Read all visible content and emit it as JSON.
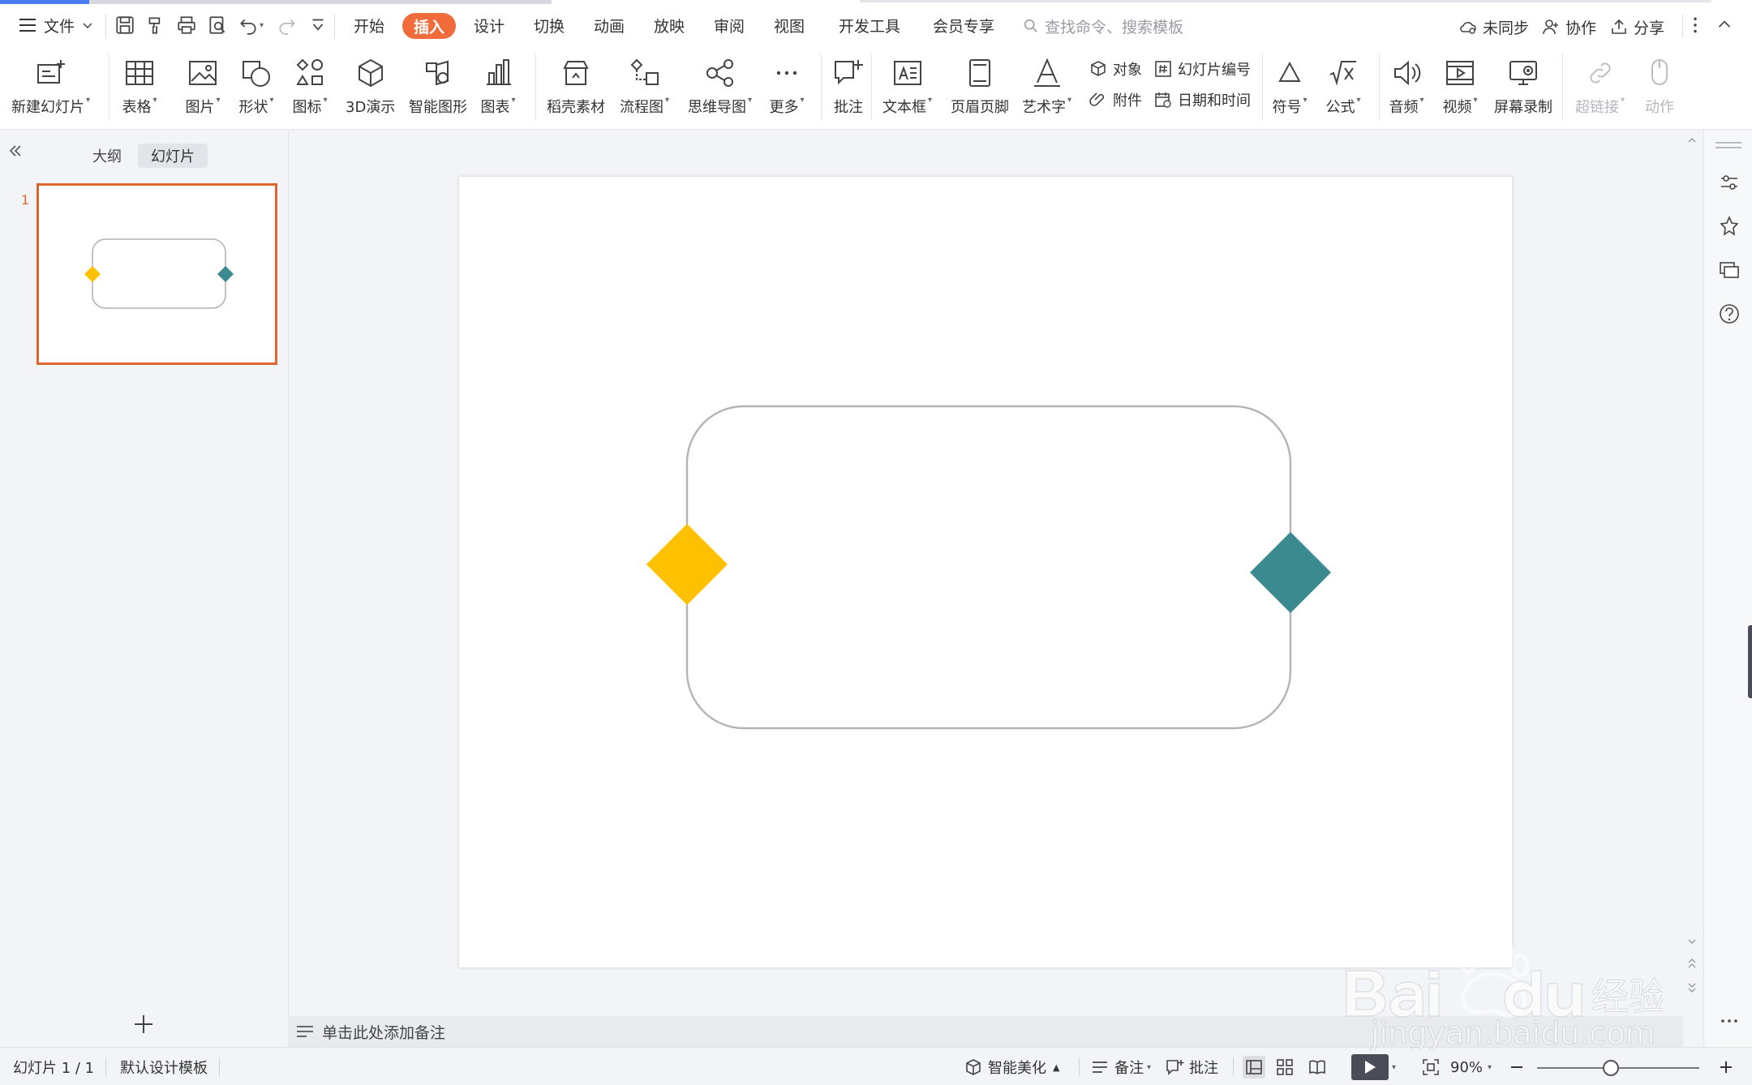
{
  "menubar": {
    "file_label": "文件",
    "tabs": [
      {
        "label": "开始"
      },
      {
        "label": "插入"
      },
      {
        "label": "设计"
      },
      {
        "label": "切换"
      },
      {
        "label": "动画"
      },
      {
        "label": "放映"
      },
      {
        "label": "审阅"
      },
      {
        "label": "视图"
      },
      {
        "label": "开发工具"
      },
      {
        "label": "会员专享"
      }
    ],
    "search_placeholder": "查找命令、搜索模板",
    "sync_label": "未同步",
    "collab_label": "协作",
    "share_label": "分享"
  },
  "ribbon": {
    "new_slide": "新建幻灯片",
    "table": "表格",
    "picture": "图片",
    "shape": "形状",
    "icon": "图标",
    "threed": "3D演示",
    "smartart": "智能图形",
    "chart": "图表",
    "daoke": "稻壳素材",
    "flowchart": "流程图",
    "mindmap": "思维导图",
    "more": "更多",
    "comment": "批注",
    "textbox": "文本框",
    "header_footer": "页眉页脚",
    "wordart": "艺术字",
    "object": "对象",
    "slide_number": "幻灯片编号",
    "attachment": "附件",
    "datetime": "日期和时间",
    "symbol": "符号",
    "formula": "公式",
    "audio": "音频",
    "video": "视频",
    "screen_record": "屏幕录制",
    "hyperlink": "超链接",
    "action": "动作"
  },
  "leftpanel": {
    "tab_outline": "大纲",
    "tab_slides": "幻灯片",
    "slide_number": "1"
  },
  "notes": {
    "placeholder": "单击此处添加备注"
  },
  "statusbar": {
    "slide_info": "幻灯片 1 / 1",
    "template": "默认设计模板",
    "beautify": "智能美化",
    "notes": "备注",
    "comments": "批注",
    "zoom": "90%"
  },
  "colors": {
    "accent_orange": "#f26b3a",
    "diamond_yellow": "#ffc000",
    "diamond_teal": "#3b8a8f",
    "frame_grey": "#b4b4b4"
  }
}
